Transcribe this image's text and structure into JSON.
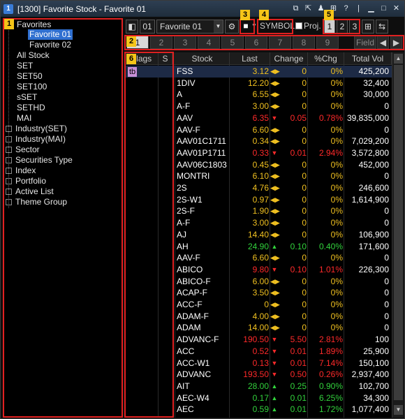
{
  "window": {
    "title": "[1300] Favorite Stock - Favorite 01",
    "icon_text": "1",
    "controls": [
      "restore-icon",
      "share-icon",
      "person-icon",
      "grid-icon",
      "help-icon",
      "minimize-icon",
      "maximize-icon",
      "close-icon"
    ]
  },
  "badges": [
    "1",
    "2",
    "3",
    "4",
    "5",
    "6"
  ],
  "tree": {
    "root": "Favorites",
    "favorites": [
      "Favorite 01",
      "Favorite 02"
    ],
    "items": [
      "All Stock",
      "SET",
      "SET50",
      "SET100",
      "sSET",
      "SETHD",
      "MAI"
    ],
    "groups": [
      "Industry(SET)",
      "Industry(MAI)",
      "Sector",
      "Securities Type",
      "Index",
      "Portfolio",
      "Active List",
      "Theme Group"
    ]
  },
  "toolbar": {
    "number": "01",
    "favorite_select": "Favorite 01",
    "symbol_label": "SYMBOL",
    "proj_label": "Proj.",
    "page_buttons": [
      "1",
      "2",
      "3"
    ]
  },
  "tabs": {
    "labels": [
      "1",
      "2",
      "3",
      "4",
      "5",
      "6",
      "7",
      "8",
      "9"
    ],
    "field_label": "Field"
  },
  "grid": {
    "headers": {
      "flags": "Flags",
      "s": "S",
      "stock": "Stock",
      "last": "Last",
      "change": "Change",
      "pct": "%Chg",
      "vol": "Total Vol"
    },
    "flag_text": "tb",
    "rows": [
      {
        "stock": "FSS",
        "last": "3.12",
        "dir": "flat",
        "change": "0",
        "pct": "0%",
        "vol": "425,200"
      },
      {
        "stock": "1DIV",
        "last": "12.20",
        "dir": "flat",
        "change": "0",
        "pct": "0%",
        "vol": "32,400"
      },
      {
        "stock": "A",
        "last": "6.55",
        "dir": "flat",
        "change": "0",
        "pct": "0%",
        "vol": "30,000"
      },
      {
        "stock": "A-F",
        "last": "3.00",
        "dir": "flat",
        "change": "0",
        "pct": "0%",
        "vol": "0"
      },
      {
        "stock": "AAV",
        "last": "6.35",
        "dir": "down",
        "change": "0.05",
        "pct": "0.78%",
        "vol": "39,835,000"
      },
      {
        "stock": "AAV-F",
        "last": "6.60",
        "dir": "flat",
        "change": "0",
        "pct": "0%",
        "vol": "0"
      },
      {
        "stock": "AAV01C1711",
        "last": "0.34",
        "dir": "flat",
        "change": "0",
        "pct": "0%",
        "vol": "7,029,200"
      },
      {
        "stock": "AAV01P1711",
        "last": "0.33",
        "dir": "down",
        "change": "0.01",
        "pct": "2.94%",
        "vol": "3,572,800"
      },
      {
        "stock": "AAV06C1803",
        "last": "0.45",
        "dir": "flat",
        "change": "0",
        "pct": "0%",
        "vol": "452,000"
      },
      {
        "stock": "MONTRI",
        "last": "6.10",
        "dir": "flat",
        "change": "0",
        "pct": "0%",
        "vol": "0"
      },
      {
        "stock": "2S",
        "last": "4.76",
        "dir": "flat",
        "change": "0",
        "pct": "0%",
        "vol": "246,600"
      },
      {
        "stock": "2S-W1",
        "last": "0.97",
        "dir": "flat",
        "change": "0",
        "pct": "0%",
        "vol": "1,614,900"
      },
      {
        "stock": "2S-F",
        "last": "1.90",
        "dir": "flat",
        "change": "0",
        "pct": "0%",
        "vol": "0"
      },
      {
        "stock": "A-F",
        "last": "3.00",
        "dir": "flat",
        "change": "0",
        "pct": "0%",
        "vol": "0"
      },
      {
        "stock": "AJ",
        "last": "14.40",
        "dir": "flat",
        "change": "0",
        "pct": "0%",
        "vol": "106,900"
      },
      {
        "stock": "AH",
        "last": "24.90",
        "dir": "up",
        "change": "0.10",
        "pct": "0.40%",
        "vol": "171,600"
      },
      {
        "stock": "AAV-F",
        "last": "6.60",
        "dir": "flat",
        "change": "0",
        "pct": "0%",
        "vol": "0"
      },
      {
        "stock": "ABICO",
        "last": "9.80",
        "dir": "down",
        "change": "0.10",
        "pct": "1.01%",
        "vol": "226,300"
      },
      {
        "stock": "ABICO-F",
        "last": "6.00",
        "dir": "flat",
        "change": "0",
        "pct": "0%",
        "vol": "0"
      },
      {
        "stock": "ACAP-F",
        "last": "3.50",
        "dir": "flat",
        "change": "0",
        "pct": "0%",
        "vol": "0"
      },
      {
        "stock": "ACC-F",
        "last": "0",
        "dir": "flat",
        "change": "0",
        "pct": "0%",
        "vol": "0"
      },
      {
        "stock": "ADAM-F",
        "last": "4.00",
        "dir": "flat",
        "change": "0",
        "pct": "0%",
        "vol": "0"
      },
      {
        "stock": "ADAM",
        "last": "14.00",
        "dir": "flat",
        "change": "0",
        "pct": "0%",
        "vol": "0"
      },
      {
        "stock": "ADVANC-F",
        "last": "190.50",
        "dir": "down",
        "change": "5.50",
        "pct": "2.81%",
        "vol": "100"
      },
      {
        "stock": "ACC",
        "last": "0.52",
        "dir": "down",
        "change": "0.01",
        "pct": "1.89%",
        "vol": "25,900"
      },
      {
        "stock": "ACC-W1",
        "last": "0.13",
        "dir": "down",
        "change": "0.01",
        "pct": "7.14%",
        "vol": "150,100"
      },
      {
        "stock": "ADVANC",
        "last": "193.50",
        "dir": "down",
        "change": "0.50",
        "pct": "0.26%",
        "vol": "2,937,400"
      },
      {
        "stock": "AIT",
        "last": "28.00",
        "dir": "up",
        "change": "0.25",
        "pct": "0.90%",
        "vol": "102,700"
      },
      {
        "stock": "AEC-W4",
        "last": "0.17",
        "dir": "up",
        "change": "0.01",
        "pct": "6.25%",
        "vol": "34,300"
      },
      {
        "stock": "AEC",
        "last": "0.59",
        "dir": "up",
        "change": "0.01",
        "pct": "1.72%",
        "vol": "1,077,400"
      }
    ]
  }
}
